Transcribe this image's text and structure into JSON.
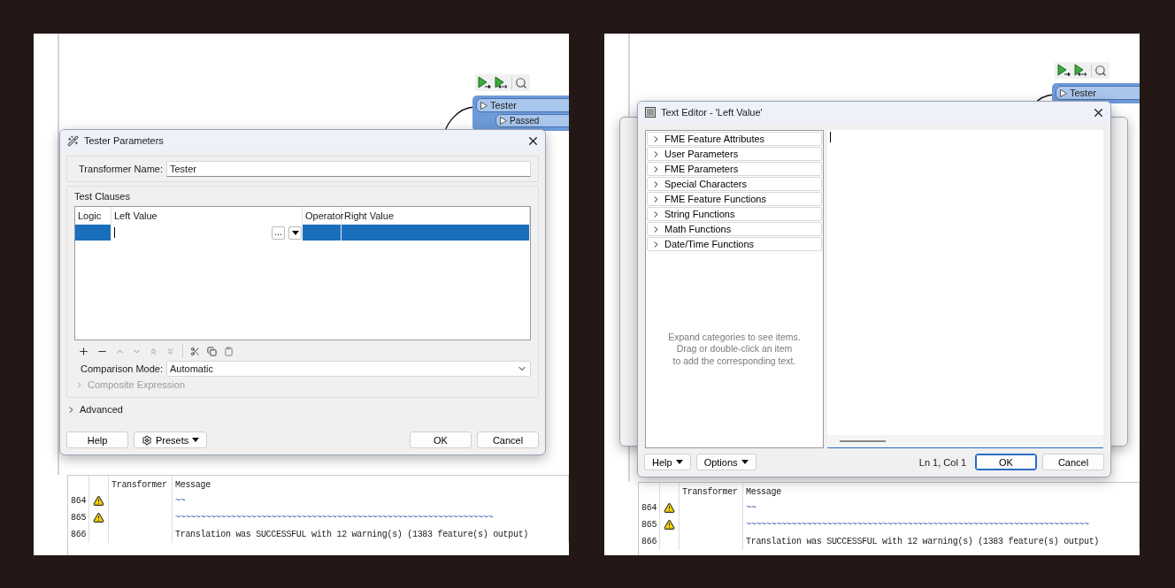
{
  "panels": [
    {
      "canvas": {
        "node": {
          "title": "Tester",
          "ports": [
            "Passed"
          ]
        }
      },
      "log": {
        "columns": [
          "Transformer",
          "Message"
        ],
        "rows": [
          {
            "number": "864",
            "warning": true,
            "message": "~~"
          },
          {
            "number": "865",
            "warning": true,
            "message": "~~~~~~~~~~~~~~~~~~~~~~~~~~~~~~~~~~~~~~~~~~~~~~~~~~~~~~~~~~~~~~~"
          },
          {
            "number": "866",
            "warning": false,
            "message": "Translation was SUCCESSFUL with 12 warning(s) (1383 feature(s) output)"
          }
        ]
      },
      "dialog": {
        "kind": "tester",
        "title": "Tester Parameters",
        "name_label": "Transformer Name:",
        "name_value": "Tester",
        "clauses": {
          "title": "Test Clauses",
          "columns": [
            "Logic",
            "Left Value",
            "Operator",
            "Right Value"
          ],
          "rows": [
            {
              "selected": true
            }
          ],
          "browse": "..."
        },
        "mode_label": "Comparison Mode:",
        "mode_value": "Automatic",
        "sections": [
          {
            "label": "Composite Expression",
            "disabled": true,
            "expanded": false
          },
          {
            "label": "Advanced",
            "disabled": false,
            "expanded": false
          }
        ],
        "buttons": [
          {
            "label": "Help",
            "kind": "plain"
          },
          {
            "label": "Presets",
            "kind": "presets"
          },
          {
            "label": "OK",
            "kind": "plain"
          },
          {
            "label": "Cancel",
            "kind": "plain"
          }
        ]
      }
    },
    {
      "canvas": {
        "node": {
          "title": "Tester"
        }
      },
      "log": {
        "columns": [
          "Transformer",
          "Message"
        ],
        "rows": [
          {
            "number": "864",
            "warning": true,
            "message": "~~"
          },
          {
            "number": "865",
            "warning": true,
            "message": "~~~~~~~~~~~~~~~~~~~~~~~~~~~~~~~~~~~~~~~~~~~~~~~~~~~~~~~~~~~~~~~~~~~~"
          },
          {
            "number": "866",
            "warning": false,
            "message": "Translation was SUCCESSFUL with 12 warning(s) (1383 feature(s) output)"
          }
        ]
      },
      "dialog": {
        "kind": "text_editor",
        "title": "Text Editor - 'Left Value'",
        "categories": [
          {
            "label": "FME Feature Attributes",
            "expanded": false
          },
          {
            "label": "User Parameters",
            "expanded": false
          },
          {
            "label": "FME Parameters",
            "expanded": false
          },
          {
            "label": "Special Characters",
            "expanded": false
          },
          {
            "label": "FME Feature Functions",
            "expanded": false
          },
          {
            "label": "String Functions",
            "expanded": false
          },
          {
            "label": "Math Functions",
            "expanded": false
          },
          {
            "label": "Date/Time Functions",
            "expanded": false
          }
        ],
        "hint": "Expand categories to see items.\nDrag or double-click an item\nto add the corresponding text.",
        "position": "Ln 1, Col 1",
        "buttons": [
          {
            "label": "Help",
            "kind": "menu"
          },
          {
            "label": "Options",
            "kind": "menu"
          },
          {
            "label": "OK",
            "kind": "default"
          },
          {
            "label": "Cancel",
            "kind": "plain"
          }
        ]
      }
    }
  ]
}
